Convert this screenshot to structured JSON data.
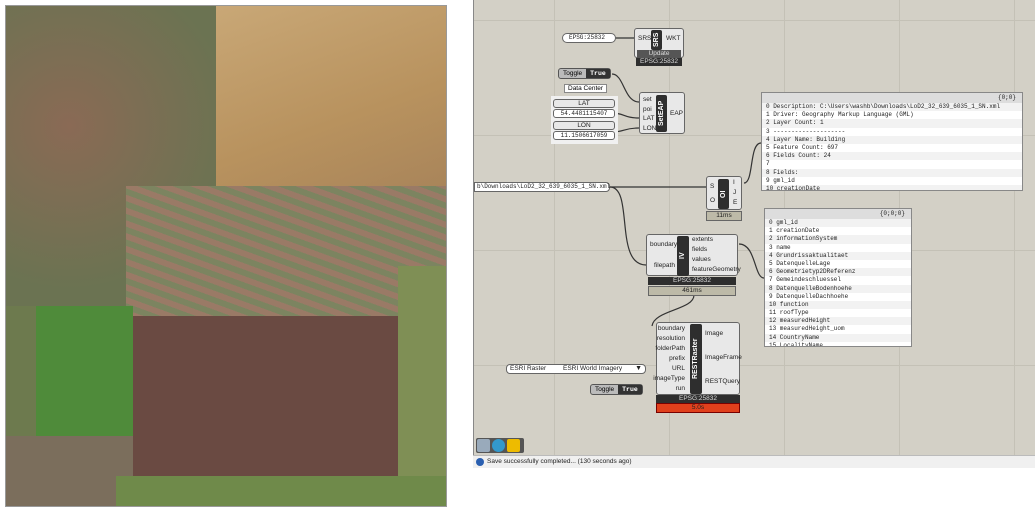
{
  "aerial": {
    "description_icon": "aerial-imagery"
  },
  "srs": {
    "input": "EPSG:25832",
    "in_pin": "SRS",
    "core": "SRS",
    "out_pin": "WKT",
    "button": "Update",
    "footer": "EPSG:25832"
  },
  "toggle1": {
    "label": "Toggle",
    "value": "True"
  },
  "data_center": {
    "tooltip": "Data Center",
    "lat_label": "LAT",
    "lat_value": "54.4481115407",
    "lon_label": "LON",
    "lon_value": "11.1506617059"
  },
  "seteap": {
    "inputs": [
      "set",
      "poi",
      "LAT",
      "LON"
    ],
    "core": "SetEAP",
    "output": "EAP"
  },
  "filepath": {
    "value": "b\\Downloads\\LoD2_32_639_6035_1_SN.xml"
  },
  "oi": {
    "inputs": [
      "S",
      "O"
    ],
    "core": "OI",
    "outputs": [
      "I",
      "J",
      "E"
    ],
    "timing": "11ms"
  },
  "info_panel": {
    "path": "{0;0}",
    "rows": [
      "0 Description: C:\\Users\\washb\\Downloads\\LoD2_32_639_6035_1_SN.xml",
      "1 Driver: Geography Markup Language (GML)",
      "2 Layer Count: 1",
      "3 --------------------",
      "4 Layer Name: Building",
      "5 Feature Count: 697",
      "6 Fields Count: 24",
      "7",
      "8 Fields:",
      "9   gml_id",
      "10   creationDate"
    ]
  },
  "iv": {
    "inputs": [
      "boundary",
      "filepath"
    ],
    "core": "IV",
    "outputs": [
      "extents",
      "fields",
      "values",
      "featureGeometry"
    ],
    "footer": "EPSG:25832",
    "timing": "461ms"
  },
  "fields_panel": {
    "path": "{0;0;0}",
    "rows": [
      "0 gml_id",
      "1 creationDate",
      "2 informationSystem",
      "3 name",
      "4 Grundrissaktualitaet",
      "5 DatenquelleLage",
      "6 Geometrietyp2DReferenz",
      "7 Gemeindeschluessel",
      "8 DatenquelleBodenhoehe",
      "9 DatenquelleDachhoehe",
      "10 function",
      "11 roofType",
      "12 measuredHeight",
      "13 measuredHeight_uom",
      "14 CountryName",
      "15 LocalityName"
    ]
  },
  "raster_select": {
    "label": "ESRI Raster",
    "value": "ESRI World Imagery"
  },
  "toggle2": {
    "label": "Toggle",
    "value": "True"
  },
  "restraster": {
    "inputs": [
      "boundary",
      "resolution",
      "folderPath",
      "prefix",
      "URL",
      "imageType",
      "run"
    ],
    "core": "RESTRaster",
    "outputs": [
      "Image",
      "ImageFrame",
      "RESTQuery"
    ],
    "footer": "EPSG:25832",
    "timing": "5.0s"
  },
  "status": {
    "message": "Save successfully completed... (130 seconds ago)"
  },
  "colors": {
    "canvas": "#d3d0c6",
    "error": "#e0401c",
    "core": "#2e2e2e"
  }
}
